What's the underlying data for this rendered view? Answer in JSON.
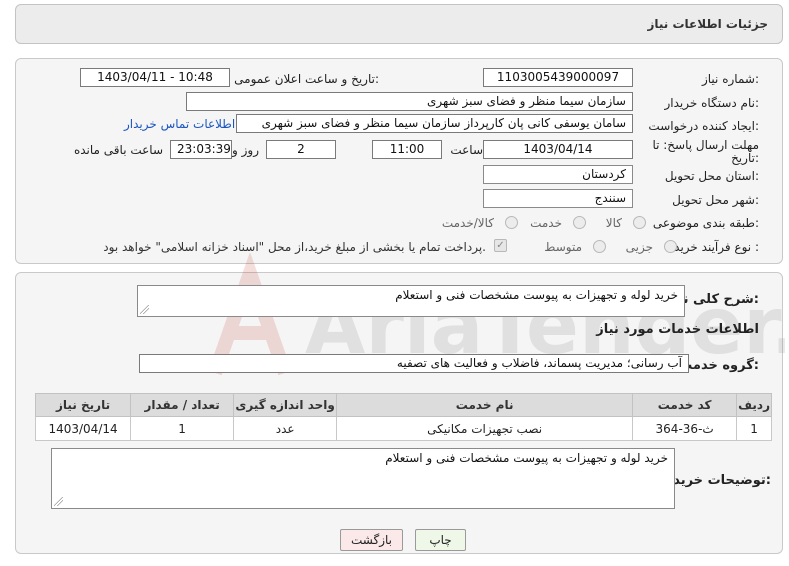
{
  "header": {
    "title": "جزئیات اطلاعات نیاز"
  },
  "form": {
    "need_number": {
      "label": "شماره نیاز:",
      "value": "1103005439000097"
    },
    "announce": {
      "label": "تاریخ و ساعت اعلان عمومی:",
      "value": "1403/04/11 - 10:48"
    },
    "buyer_org": {
      "label": "نام دستگاه خریدار:",
      "value": "سازمان سیما  منظر و فضای سبز شهری"
    },
    "requester": {
      "label": "ایجاد کننده درخواست:",
      "value": "سامان یوسفی کانی پان کارپرداز سازمان سیما  منظر و فضای سبز شهری"
    },
    "contact_link": "اطلاعات تماس خریدار",
    "deadline": {
      "label_line1": "مهلت ارسال پاسخ: تا",
      "label_line2": "تاریخ:",
      "date": "1403/04/14",
      "time_label": "ساعت",
      "time": "11:00",
      "days": "2",
      "days_label": "روز و",
      "remaining": "23:03:39",
      "remaining_label": "ساعت باقی مانده"
    },
    "province": {
      "label": "استان محل تحویل:",
      "value": "کردستان"
    },
    "city": {
      "label": "شهر محل تحویل:",
      "value": "سنندج"
    },
    "category": {
      "label": "طبقه بندی موضوعی:",
      "options": [
        "کالا",
        "خدمت",
        "کالا/خدمت"
      ]
    },
    "process": {
      "label": "نوع فرآیند خرید :",
      "options": [
        "جزیی",
        "متوسط"
      ],
      "payment_note": "پرداخت تمام یا بخشی از مبلغ خرید،از محل \"اسناد خزانه اسلامی\" خواهد بود."
    }
  },
  "summary": {
    "label": "شرح کلی نیاز:",
    "value": "خرید لوله و تجهیزات به پیوست مشخصات فنی و استعلام"
  },
  "services_title": "اطلاعات خدمات مورد نیاز",
  "service_group": {
    "label": "گروه خدمت:",
    "value": "آب رسانی؛ مدیریت پسماند، فاضلاب و فعالیت های تصفیه"
  },
  "table": {
    "headers": [
      "ردیف",
      "کد خدمت",
      "نام خدمت",
      "واحد اندازه گیری",
      "تعداد / مقدار",
      "تاریخ نیاز"
    ],
    "rows": [
      [
        "1",
        "ث-36-364",
        "نصب تجهیزات مکانیکی",
        "عدد",
        "1",
        "1403/04/14"
      ]
    ]
  },
  "buyer_notes": {
    "label": "توضیحات خریدار:",
    "value": "خرید لوله و تجهیزات به پیوست مشخصات فنی و استعلام"
  },
  "buttons": {
    "print": "چاپ",
    "back": "بازگشت"
  },
  "watermark": {
    "text": "AriaTender.neT"
  },
  "colors": {
    "link": "#1a55c0",
    "watermark": "#c0392b"
  }
}
